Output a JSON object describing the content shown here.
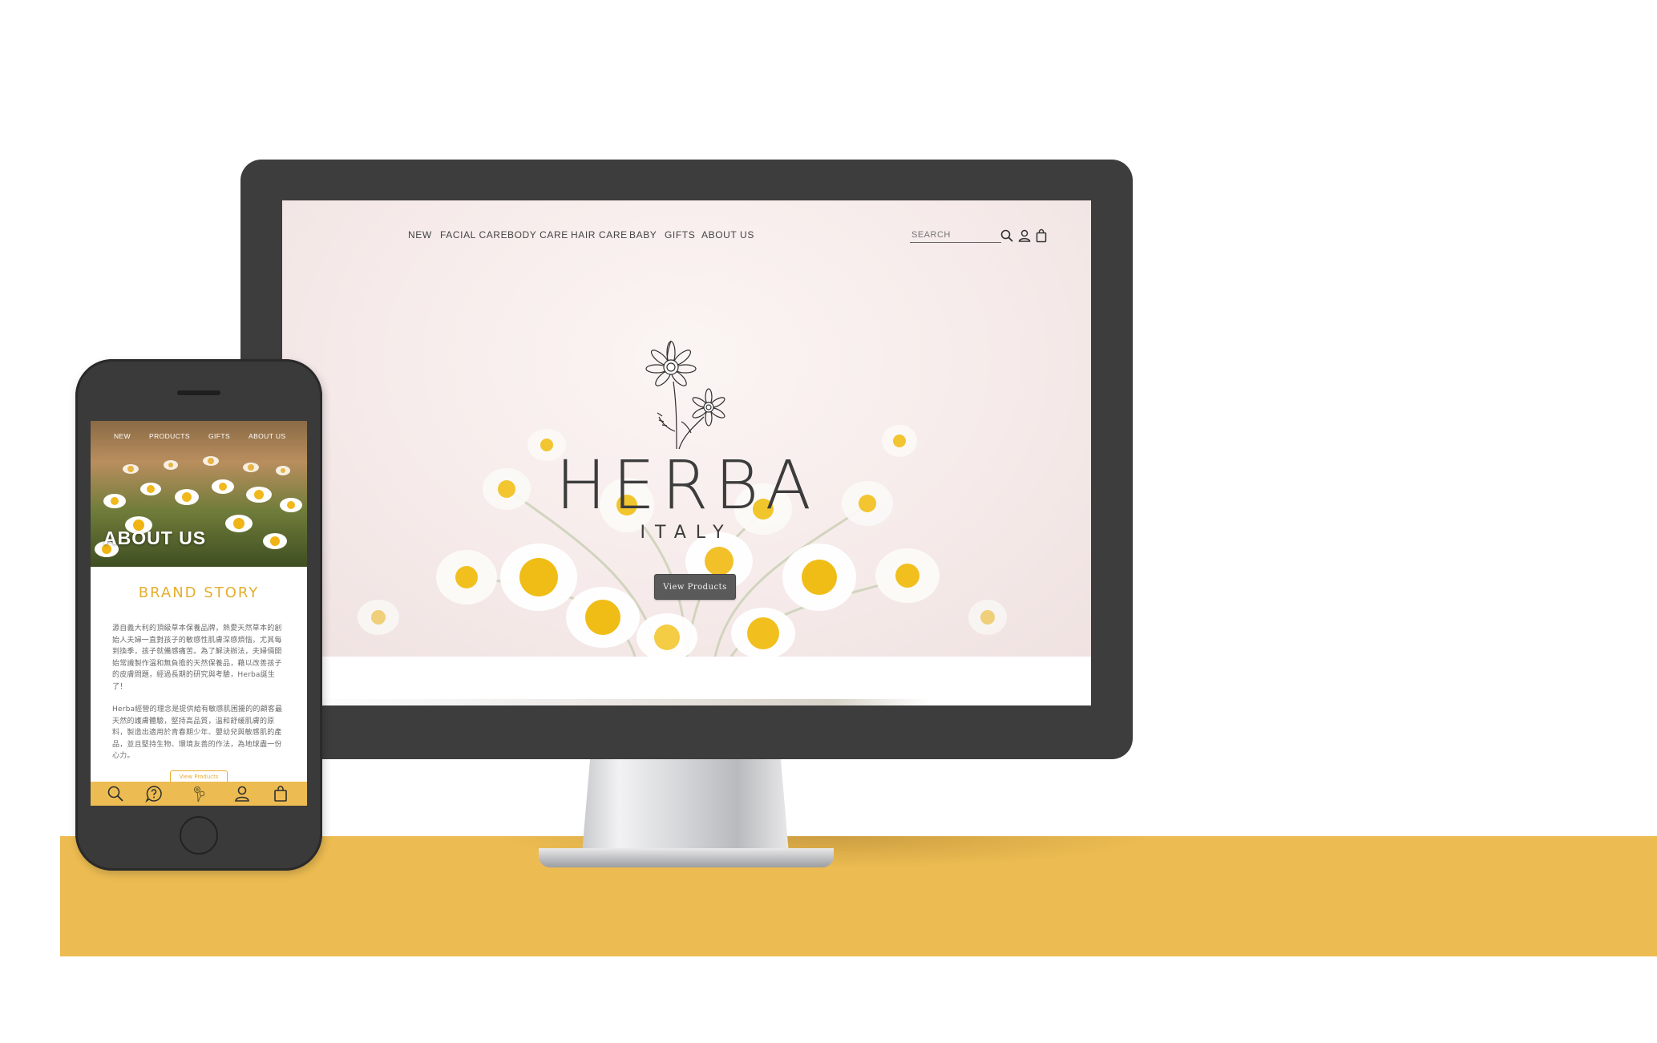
{
  "desktop": {
    "nav": {
      "items": [
        "NEW",
        "FACIAL CARE",
        "BODY CARE",
        "HAIR CARE",
        "BABY",
        "GIFTS",
        "ABOUT US"
      ],
      "search_placeholder": "SEARCH"
    },
    "icons": [
      "search-icon",
      "user-icon",
      "bag-icon",
      "daisy-illustration"
    ],
    "hero": {
      "brand": "HERBA",
      "subtitle": "ITALY",
      "cta": "View Products"
    }
  },
  "mobile": {
    "nav": {
      "items": [
        "NEW",
        "PRODUCTS",
        "GIFTS",
        "ABOUT US"
      ]
    },
    "hero_title": "ABOUT US",
    "section_title": "BRAND STORY",
    "paragraph1": "源自義大利的頂級草本保養品牌，熱愛天然草本的創始人夫婦一直對孩子的敏感性肌膚深感煩惱，尤其每到換季，孩子就備感痛苦。為了解決辦法，夫婦倆開始常識製作溫和無負擔的天然保養品，藉以改善孩子的皮膚問題，經過長期的研究與考驗，Herba誕生了！",
    "paragraph2": "Herba經營的理念是提供給有敏感肌困擾的的顧客最天然的護膚體驗，堅持高品質，溫和舒緩肌膚的原料，製造出適用於青春期少年、嬰幼兒與敏感肌的產品，並且堅持生物、環境友善的作法，為地球盡一份心力。",
    "small_button": "View Products",
    "tabbar_icons": [
      "search-icon",
      "help-icon",
      "flower-icon",
      "user-icon",
      "bag-icon"
    ]
  },
  "colors": {
    "accent_yellow": "#ecbc52",
    "mobile_heading": "#e5ae2f",
    "device_frame": "#3d3d3d",
    "button_dark": "#5a5a5a"
  }
}
